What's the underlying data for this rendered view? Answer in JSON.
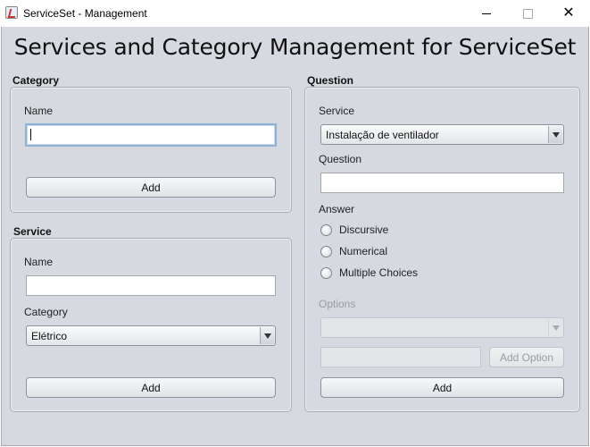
{
  "window": {
    "title": "ServiceSet - Management",
    "minimize_icon": "minimize-icon",
    "maximize_icon": "maximize-icon",
    "close_icon": "close-icon",
    "close_glyph": "✕"
  },
  "heading": "Services and Category Management for ServiceSet",
  "category": {
    "group_title": "Category",
    "name_label": "Name",
    "name_value": "",
    "add_button": "Add"
  },
  "service": {
    "group_title": "Service",
    "name_label": "Name",
    "name_value": "",
    "category_label": "Category",
    "category_selected": "Elétrico",
    "add_button": "Add"
  },
  "question": {
    "group_title": "Question",
    "service_label": "Service",
    "service_selected": "Instalação de ventilador",
    "question_label": "Question",
    "question_value": "",
    "answer_label": "Answer",
    "answer_options": [
      "Discursive",
      "Numerical",
      "Multiple Choices"
    ],
    "options_label": "Options",
    "options_selected": "",
    "option_input_value": "",
    "add_option_button": "Add Option",
    "add_button": "Add"
  }
}
